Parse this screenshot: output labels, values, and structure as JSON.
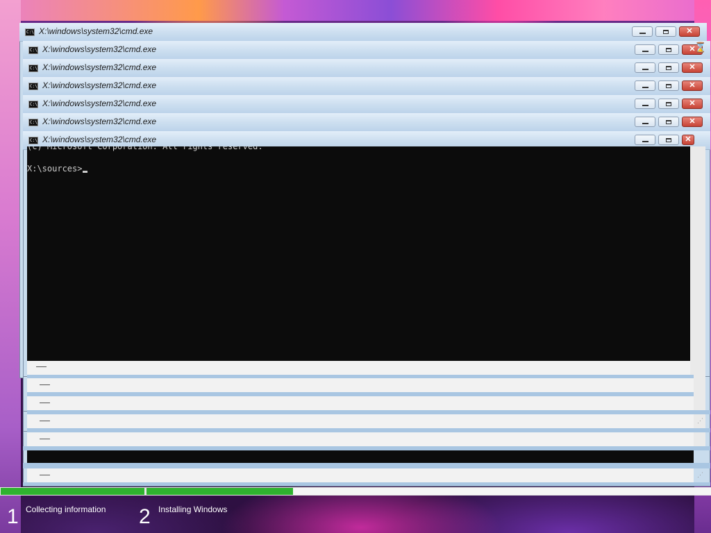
{
  "windows": [
    {
      "title": "X:\\windows\\system32\\cmd.exe"
    },
    {
      "title": "X:\\windows\\system32\\cmd.exe"
    },
    {
      "title": "X:\\windows\\system32\\cmd.exe"
    },
    {
      "title": "X:\\windows\\system32\\cmd.exe"
    },
    {
      "title": "X:\\windows\\system32\\cmd.exe"
    },
    {
      "title": "X:\\windows\\system32\\cmd.exe"
    },
    {
      "title": "X:\\windows\\system32\\cmd.exe"
    }
  ],
  "console": {
    "partial_line": "(c) Microsoft Corporation. All rights reserved.",
    "prompt": "X:\\sources>"
  },
  "setup": {
    "steps": [
      {
        "number": "1",
        "label": "Collecting information",
        "progress": 1.0
      },
      {
        "number": "2",
        "label": "Installing Windows",
        "progress": 0.26
      }
    ],
    "accent_color": "#2fb22f"
  },
  "icons": {
    "window_icon": "cmd-icon",
    "minimize": "minimize-icon",
    "maximize": "maximize-icon",
    "close": "close-icon"
  }
}
